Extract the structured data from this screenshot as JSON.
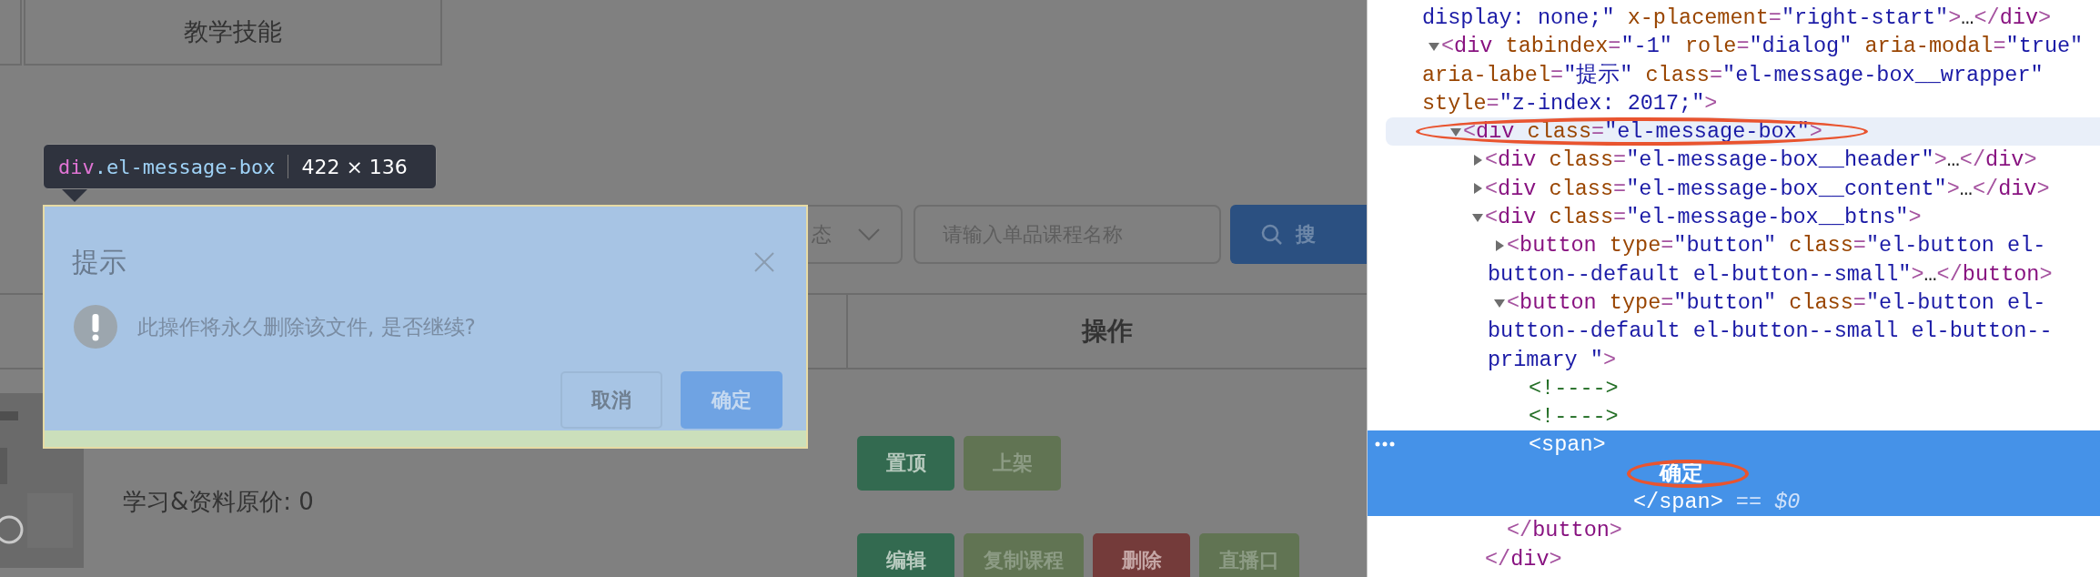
{
  "page": {
    "tabs": [
      {
        "label": "教学技能"
      }
    ],
    "filters": {
      "status_select": {
        "value": "态"
      },
      "search_input": {
        "placeholder": "请输入单品课程名称"
      },
      "search_button": {
        "label": "搜"
      }
    },
    "table": {
      "columns": [
        {
          "label": "操作"
        }
      ],
      "row": {
        "thumbnail": {
          "kind": "picture"
        },
        "prices": [
          "学习&资料原价: 0"
        ],
        "actions": [
          [
            {
              "label": "置顶",
              "kind": "success"
            },
            {
              "label": "上架",
              "kind": "light"
            }
          ],
          [
            {
              "label": "编辑",
              "kind": "success"
            },
            {
              "label": "复制课程",
              "kind": "light"
            },
            {
              "label": "删除",
              "kind": "danger"
            },
            {
              "label": "直播口",
              "kind": "light"
            }
          ]
        ]
      }
    }
  },
  "inspector_tooltip": {
    "tag": "div",
    "selector": ".el-message-box",
    "size": "422 × 136"
  },
  "dialog": {
    "title": "提示",
    "message": "此操作将永久删除该文件, 是否继续?",
    "buttons": [
      {
        "label": "取消",
        "kind": "default"
      },
      {
        "label": "确定",
        "kind": "primary"
      }
    ]
  },
  "devtools": {
    "nodes": [
      {
        "kind": "continuation",
        "selected": false,
        "lines": [
          [
            {
              "kind": "value",
              "text": "display: none;\""
            },
            {
              "kind": "attr",
              "text": " x-placement"
            },
            {
              "kind": "punct",
              "text": "="
            },
            {
              "kind": "value",
              "text": "\"right-start\""
            },
            {
              "kind": "punct",
              "text": ">"
            },
            {
              "kind": "plain",
              "text": "…"
            },
            {
              "kind": "punct",
              "text": "</"
            },
            {
              "kind": "tag",
              "text": "div"
            },
            {
              "kind": "punct",
              "text": ">"
            }
          ]
        ]
      },
      {
        "expanded": true,
        "selected": false,
        "lines": [
          [
            {
              "kind": "punct",
              "text": "<"
            },
            {
              "kind": "tag",
              "text": "div"
            },
            {
              "kind": "attr",
              "text": " tabindex"
            },
            {
              "kind": "punct",
              "text": "="
            },
            {
              "kind": "value",
              "text": "\"-1\""
            },
            {
              "kind": "attr",
              "text": " role"
            },
            {
              "kind": "punct",
              "text": "="
            },
            {
              "kind": "value",
              "text": "\"dialog\""
            },
            {
              "kind": "attr",
              "text": " aria-modal"
            },
            {
              "kind": "punct",
              "text": "="
            },
            {
              "kind": "value",
              "text": "\"true\""
            }
          ],
          [
            {
              "kind": "attr",
              "text": "aria-label"
            },
            {
              "kind": "punct",
              "text": "="
            },
            {
              "kind": "value",
              "text": "\"提示\""
            },
            {
              "kind": "attr",
              "text": " class"
            },
            {
              "kind": "punct",
              "text": "="
            },
            {
              "kind": "value",
              "text": "\"el-message-box__wrapper\""
            }
          ],
          [
            {
              "kind": "attr",
              "text": "style"
            },
            {
              "kind": "punct",
              "text": "="
            },
            {
              "kind": "value",
              "text": "\"z-index: 2017;\""
            },
            {
              "kind": "punct",
              "text": ">"
            }
          ]
        ],
        "children": [
          {
            "expanded": true,
            "selected": false,
            "hovered": true,
            "circled": true,
            "lines": [
              [
                {
                  "kind": "punct",
                  "text": "<"
                },
                {
                  "kind": "tag",
                  "text": "div"
                },
                {
                  "kind": "attr",
                  "text": " class"
                },
                {
                  "kind": "punct",
                  "text": "="
                },
                {
                  "kind": "value",
                  "text": "\"el-message-box\""
                },
                {
                  "kind": "punct",
                  "text": ">"
                }
              ]
            ],
            "children": [
              {
                "expanded": false,
                "selected": false,
                "lines": [
                  [
                    {
                      "kind": "punct",
                      "text": "<"
                    },
                    {
                      "kind": "tag",
                      "text": "div"
                    },
                    {
                      "kind": "attr",
                      "text": " class"
                    },
                    {
                      "kind": "punct",
                      "text": "="
                    },
                    {
                      "kind": "value",
                      "text": "\"el-message-box__header\""
                    },
                    {
                      "kind": "punct",
                      "text": ">"
                    },
                    {
                      "kind": "plain",
                      "text": "…"
                    },
                    {
                      "kind": "punct",
                      "text": "</"
                    },
                    {
                      "kind": "tag",
                      "text": "div"
                    },
                    {
                      "kind": "punct",
                      "text": ">"
                    }
                  ]
                ]
              },
              {
                "expanded": false,
                "selected": false,
                "lines": [
                  [
                    {
                      "kind": "punct",
                      "text": "<"
                    },
                    {
                      "kind": "tag",
                      "text": "div"
                    },
                    {
                      "kind": "attr",
                      "text": " class"
                    },
                    {
                      "kind": "punct",
                      "text": "="
                    },
                    {
                      "kind": "value",
                      "text": "\"el-message-box__content\""
                    },
                    {
                      "kind": "punct",
                      "text": ">"
                    },
                    {
                      "kind": "plain",
                      "text": "…"
                    },
                    {
                      "kind": "punct",
                      "text": "</"
                    },
                    {
                      "kind": "tag",
                      "text": "div"
                    },
                    {
                      "kind": "punct",
                      "text": ">"
                    }
                  ]
                ]
              },
              {
                "expanded": true,
                "selected": false,
                "lines": [
                  [
                    {
                      "kind": "punct",
                      "text": "<"
                    },
                    {
                      "kind": "tag",
                      "text": "div"
                    },
                    {
                      "kind": "attr",
                      "text": " class"
                    },
                    {
                      "kind": "punct",
                      "text": "="
                    },
                    {
                      "kind": "value",
                      "text": "\"el-message-box__btns\""
                    },
                    {
                      "kind": "punct",
                      "text": ">"
                    }
                  ]
                ],
                "children": [
                  {
                    "expanded": false,
                    "selected": false,
                    "lines": [
                      [
                        {
                          "kind": "punct",
                          "text": "<"
                        },
                        {
                          "kind": "tag",
                          "text": "button"
                        },
                        {
                          "kind": "attr",
                          "text": " type"
                        },
                        {
                          "kind": "punct",
                          "text": "="
                        },
                        {
                          "kind": "value",
                          "text": "\"button\""
                        },
                        {
                          "kind": "attr",
                          "text": " class"
                        },
                        {
                          "kind": "punct",
                          "text": "="
                        },
                        {
                          "kind": "value",
                          "text": "\"el-button el-"
                        }
                      ],
                      [
                        {
                          "kind": "value",
                          "text": "button--default el-button--small\""
                        },
                        {
                          "kind": "punct",
                          "text": ">"
                        },
                        {
                          "kind": "plain",
                          "text": "…"
                        },
                        {
                          "kind": "punct",
                          "text": "</"
                        },
                        {
                          "kind": "tag",
                          "text": "button"
                        },
                        {
                          "kind": "punct",
                          "text": ">"
                        }
                      ]
                    ]
                  },
                  {
                    "expanded": true,
                    "selected": false,
                    "lines": [
                      [
                        {
                          "kind": "punct",
                          "text": "<"
                        },
                        {
                          "kind": "tag",
                          "text": "button"
                        },
                        {
                          "kind": "attr",
                          "text": " type"
                        },
                        {
                          "kind": "punct",
                          "text": "="
                        },
                        {
                          "kind": "value",
                          "text": "\"button\""
                        },
                        {
                          "kind": "attr",
                          "text": " class"
                        },
                        {
                          "kind": "punct",
                          "text": "="
                        },
                        {
                          "kind": "value",
                          "text": "\"el-button el-"
                        }
                      ],
                      [
                        {
                          "kind": "value",
                          "text": "button--default el-button--small el-button--"
                        }
                      ],
                      [
                        {
                          "kind": "value",
                          "text": "primary \""
                        },
                        {
                          "kind": "punct",
                          "text": ">"
                        }
                      ]
                    ],
                    "children": [
                      {
                        "selected": false,
                        "lines": [
                          [
                            {
                              "kind": "comment",
                              "text": "<!---->"
                            }
                          ]
                        ]
                      },
                      {
                        "selected": false,
                        "lines": [
                          [
                            {
                              "kind": "comment",
                              "text": "<!---->"
                            }
                          ]
                        ]
                      },
                      {
                        "selected": true,
                        "lines": [
                          [
                            {
                              "kind": "punct",
                              "text": "<"
                            },
                            {
                              "kind": "tag",
                              "text": "span"
                            },
                            {
                              "kind": "punct",
                              "text": ">"
                            }
                          ]
                        ],
                        "children": [
                          {
                            "kind": "text",
                            "selected": false,
                            "circled": true,
                            "lines": [
                              [
                                {
                                  "kind": "plain",
                                  "text": "确定"
                                }
                              ]
                            ]
                          }
                        ],
                        "closing": [
                          {
                            "kind": "punct",
                            "text": "</"
                          },
                          {
                            "kind": "tag",
                            "text": "span"
                          },
                          {
                            "kind": "punct",
                            "text": ">"
                          },
                          {
                            "kind": "dim",
                            "text": " == $0"
                          }
                        ]
                      }
                    ],
                    "closing": [
                      {
                        "kind": "punct",
                        "text": "</"
                      },
                      {
                        "kind": "tag",
                        "text": "button"
                      },
                      {
                        "kind": "punct",
                        "text": ">"
                      }
                    ]
                  }
                ],
                "closing": [
                  {
                    "kind": "punct",
                    "text": "</"
                  },
                  {
                    "kind": "tag",
                    "text": "div"
                  },
                  {
                    "kind": "punct",
                    "text": ">"
                  }
                ]
              }
            ]
          }
        ]
      }
    ]
  }
}
